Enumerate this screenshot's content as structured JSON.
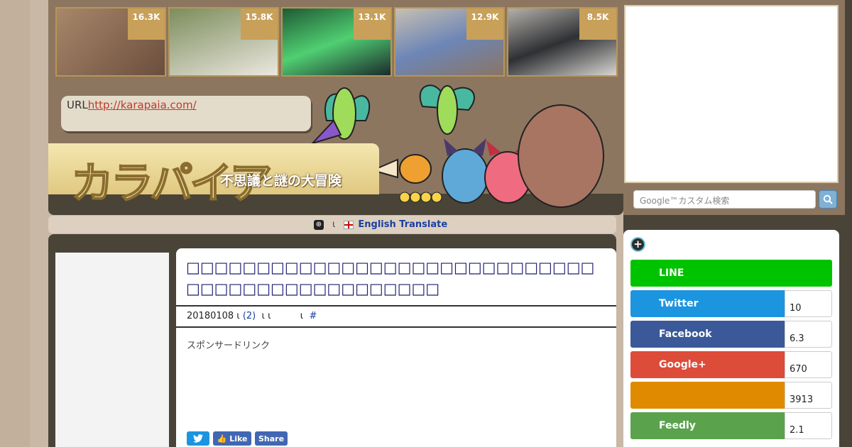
{
  "thumbnails": [
    {
      "count": "16.3K",
      "color1": "#a8876a",
      "color2": "#6b4e3d"
    },
    {
      "count": "15.8K",
      "color1": "#7c8d5b",
      "color2": "#ebe7df"
    },
    {
      "count": "13.1K",
      "color1": "#1f5a34",
      "color2": "#50cf72"
    },
    {
      "count": "12.9K",
      "color1": "#c7bfb3",
      "color2": "#6d86b6"
    },
    {
      "count": "8.5K",
      "color1": "#b3b0ab",
      "color2": "#2e3033"
    }
  ],
  "url_box": {
    "label": "URL",
    "link": "http://karapaia.com/"
  },
  "logo": {
    "text": "カラパイア",
    "tagline": "不思議と謎の大冒険"
  },
  "translate": {
    "separator": "ι",
    "label": "English Translate"
  },
  "article": {
    "title": "□□□□□□□□□□□□□□□□□□□□□□□□□□□□□□□□□□□□□□□□□□□□□□□",
    "date": "20180108 ι",
    "comments": "(2)",
    "meta_rest": " ι ι          ι ",
    "hash": "#",
    "sponsor": "スポンサードリンク"
  },
  "article_share": {
    "tweet": "",
    "like": "Like",
    "share": "Share"
  },
  "search": {
    "placeholder": "Google™カスタム検索"
  },
  "share_panel": [
    {
      "name": "LINE",
      "count": "",
      "color": "#00c300"
    },
    {
      "name": "Twitter",
      "count": "10",
      "color": "#1b95e0"
    },
    {
      "name": "Facebook",
      "count": "6.3",
      "color": "#3b5998"
    },
    {
      "name": "Google+",
      "count": "670",
      "color": "#dd4b39"
    },
    {
      "name": "",
      "count": "3913",
      "color": "#e08a00"
    },
    {
      "name": "Feedly",
      "count": "2.1",
      "color": "#5ba24d"
    }
  ]
}
